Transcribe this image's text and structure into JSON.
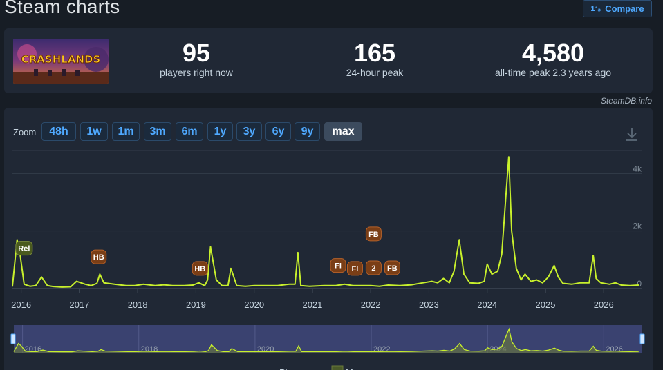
{
  "header": {
    "title": "Steam charts",
    "compare_label": "Compare",
    "compare_icon_text": "1²₃"
  },
  "stats": [
    {
      "value": "95",
      "label": "players right now"
    },
    {
      "value": "165",
      "label": "24-hour peak"
    },
    {
      "value": "4,580",
      "label": "all-time peak 2.3 years ago"
    }
  ],
  "game": {
    "logo_text": "CRASHLANDS"
  },
  "credit": "SteamDB.info",
  "zoom": {
    "label": "Zoom",
    "options": [
      "48h",
      "1w",
      "1m",
      "3m",
      "6m",
      "1y",
      "3y",
      "6y",
      "9y",
      "max"
    ],
    "active": "max"
  },
  "colors": {
    "line": "#c8f02c",
    "background": "#171d25",
    "panel": "#202835",
    "accent": "#4fa9ff",
    "marker_release": "#4a5a1e",
    "marker_event": "#7a3e16",
    "navigator_fill": "#3a4270"
  },
  "icons": {
    "download": "download-icon",
    "compare": "compare-icon"
  },
  "chart_data": {
    "type": "line",
    "ylim": [
      0,
      4800
    ],
    "y_ticks": [
      0,
      2000,
      4000
    ],
    "y_tick_labels": [
      "0",
      "2k",
      "4k"
    ],
    "x_range": [
      2015.85,
      2026.65
    ],
    "x_ticks": [
      2016,
      2017,
      2018,
      2019,
      2020,
      2021,
      2022,
      2023,
      2024,
      2025,
      2026
    ],
    "x_tick_labels": [
      "2016",
      "2017",
      "2018",
      "2019",
      "2020",
      "2021",
      "2022",
      "2023",
      "2024",
      "2025",
      "2026"
    ],
    "navigator_ticks": [
      2016,
      2018,
      2020,
      2022,
      2024,
      2026
    ],
    "navigator_tick_labels": [
      "2016",
      "2018",
      "2020",
      "2022",
      "2024",
      "2026"
    ],
    "grid": true,
    "series": [
      {
        "name": "Players",
        "x": [
          2015.85,
          2015.93,
          2015.98,
          2016.05,
          2016.15,
          2016.25,
          2016.35,
          2016.45,
          2016.55,
          2016.7,
          2016.85,
          2016.95,
          2017.1,
          2017.2,
          2017.3,
          2017.35,
          2017.42,
          2017.6,
          2017.8,
          2017.95,
          2018.1,
          2018.3,
          2018.45,
          2018.6,
          2018.8,
          2018.95,
          2019.05,
          2019.15,
          2019.2,
          2019.25,
          2019.35,
          2019.45,
          2019.55,
          2019.6,
          2019.7,
          2019.85,
          2020.0,
          2020.2,
          2020.4,
          2020.6,
          2020.7,
          2020.75,
          2020.8,
          2020.95,
          2021.2,
          2021.4,
          2021.55,
          2021.7,
          2021.85,
          2022.0,
          2022.15,
          2022.3,
          2022.5,
          2022.7,
          2022.9,
          2023.05,
          2023.15,
          2023.25,
          2023.35,
          2023.43,
          2023.52,
          2023.6,
          2023.7,
          2023.85,
          2023.95,
          2024.0,
          2024.08,
          2024.18,
          2024.25,
          2024.32,
          2024.37,
          2024.42,
          2024.5,
          2024.58,
          2024.65,
          2024.75,
          2024.85,
          2024.95,
          2025.05,
          2025.15,
          2025.22,
          2025.3,
          2025.45,
          2025.6,
          2025.75,
          2025.82,
          2025.87,
          2025.95,
          2026.1,
          2026.2,
          2026.3,
          2026.45,
          2026.6
        ],
        "values": [
          80,
          1700,
          1200,
          150,
          80,
          100,
          400,
          100,
          70,
          50,
          60,
          250,
          150,
          100,
          180,
          500,
          200,
          150,
          100,
          100,
          150,
          100,
          130,
          100,
          100,
          120,
          200,
          100,
          300,
          1450,
          300,
          100,
          100,
          700,
          100,
          80,
          100,
          100,
          100,
          150,
          150,
          1250,
          100,
          80,
          100,
          100,
          150,
          100,
          100,
          100,
          80,
          120,
          100,
          130,
          200,
          250,
          200,
          350,
          200,
          600,
          1700,
          500,
          200,
          180,
          250,
          850,
          500,
          600,
          1200,
          3200,
          4580,
          2000,
          700,
          300,
          500,
          250,
          300,
          200,
          400,
          800,
          400,
          180,
          150,
          200,
          200,
          1150,
          350,
          200,
          150,
          200,
          120,
          100,
          120
        ]
      }
    ],
    "markers": [
      {
        "label": "Rel",
        "x": 2016.05,
        "value": 1400,
        "kind": "release"
      },
      {
        "label": "HB",
        "x": 2017.33,
        "value": 1100,
        "kind": "event"
      },
      {
        "label": "HB",
        "x": 2019.07,
        "value": 700,
        "kind": "event"
      },
      {
        "label": "FI",
        "x": 2021.44,
        "value": 800,
        "kind": "event"
      },
      {
        "label": "FI",
        "x": 2021.73,
        "value": 700,
        "kind": "event"
      },
      {
        "label": "2",
        "x": 2022.05,
        "value": 720,
        "kind": "event"
      },
      {
        "label": "FB",
        "x": 2022.37,
        "value": 720,
        "kind": "event"
      },
      {
        "label": "FB",
        "x": 2022.05,
        "value": 1900,
        "kind": "event"
      }
    ],
    "legend": [
      "Players",
      "Max"
    ],
    "legend_placement": "bottom"
  }
}
